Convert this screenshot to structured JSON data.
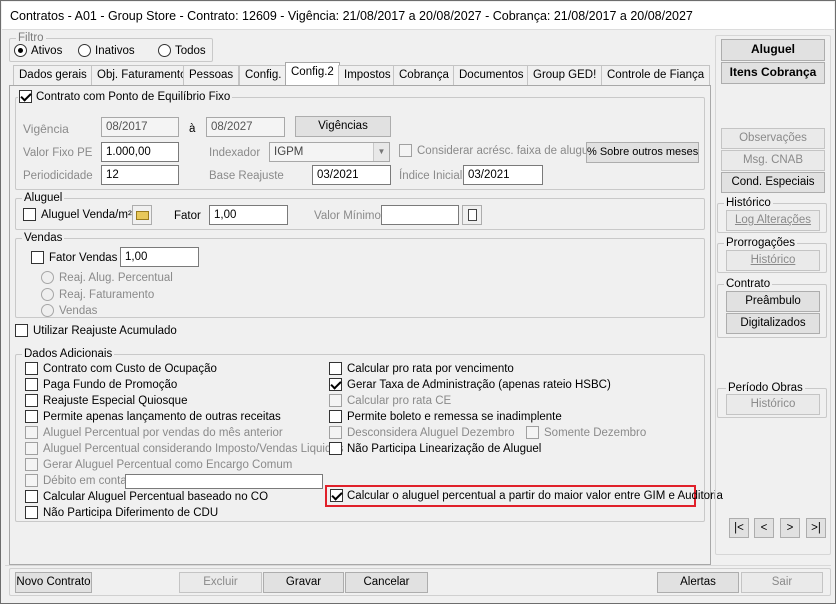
{
  "window": {
    "title": "Contratos - A01 - Group Store - Contrato: 12609 - Vigência: 21/08/2017 a 20/08/2027 - Cobrança: 21/08/2017 a 20/08/2027"
  },
  "filtro": {
    "label": "Filtro",
    "options": [
      "Ativos",
      "Inativos",
      "Todos"
    ],
    "selected": "Ativos"
  },
  "tabs": [
    "Dados gerais",
    "Obj. Faturamento",
    "Pessoas",
    "Config.",
    "Config.2",
    "Impostos",
    "Cobrança",
    "Documentos",
    "Group GED!",
    "Controle de Fiança"
  ],
  "active_tab": "Config.2",
  "pe": {
    "title": "Contrato com Ponto de Equilíbrio Fixo",
    "vigencia_label": "Vigência",
    "vigencia_from": "08/2017",
    "a_label": "à",
    "vigencia_to": "08/2027",
    "vigencias_button": "Vigências",
    "valor_fixo_label": "Valor Fixo PE",
    "valor_fixo": "1.000,00",
    "indexador_label": "Indexador",
    "indexador": "IGPM",
    "considerar_label": "Considerar acrésc. faixa de aluguel",
    "sobre_outros_button": "% Sobre outros meses",
    "periodicidade_label": "Periodicidade",
    "periodicidade": "12",
    "base_reajuste_label": "Base Reajuste",
    "base_reajuste": "03/2021",
    "indice_inicial_label": "Índice Inicial",
    "indice_inicial": "03/2021"
  },
  "aluguel": {
    "title": "Aluguel",
    "venda_m2_label": "Aluguel Venda/m²",
    "fator_label": "Fator",
    "fator": "1,00",
    "valor_minimo_label": "Valor Mínimo",
    "valor_minimo": ""
  },
  "vendas": {
    "title": "Vendas",
    "fator_vendas_label": "Fator Vendas",
    "fator_vendas": "1,00",
    "radios": [
      "Reaj. Alug. Percentual",
      "Reaj. Faturamento",
      "Vendas"
    ]
  },
  "reajuste_acumulado_label": "Utilizar Reajuste Acumulado",
  "dados": {
    "title": "Dados Adicionais",
    "left": [
      {
        "label": "Contrato com Custo de Ocupação",
        "checked": false,
        "enabled": true
      },
      {
        "label": "Paga Fundo de Promoção",
        "checked": false,
        "enabled": true
      },
      {
        "label": "Reajuste Especial Quiosque",
        "checked": false,
        "enabled": true
      },
      {
        "label": "Permite apenas lançamento de outras receitas",
        "checked": false,
        "enabled": true
      },
      {
        "label": "Aluguel Percentual por vendas do mês anterior",
        "checked": false,
        "enabled": false
      },
      {
        "label": "Aluguel Percentual considerando Imposto/Vendas Liquidas",
        "checked": false,
        "enabled": false
      },
      {
        "label": "Gerar Aluguel Percentual como Encargo Comum",
        "checked": false,
        "enabled": false
      },
      {
        "label": "Débito em conta",
        "checked": false,
        "enabled": false
      },
      {
        "label": "Calcular Aluguel Percentual baseado no CO",
        "checked": false,
        "enabled": true
      },
      {
        "label": "Não Participa Diferimento de CDU",
        "checked": false,
        "enabled": true
      }
    ],
    "right": [
      {
        "label": "Calcular pro rata por vencimento",
        "checked": false,
        "enabled": true
      },
      {
        "label": "Gerar Taxa de Administração (apenas rateio HSBC)",
        "checked": true,
        "enabled": true
      },
      {
        "label": "Calcular pro rata CE",
        "checked": false,
        "enabled": false
      },
      {
        "label": "Permite boleto e remessa se inadimplente",
        "checked": false,
        "enabled": true
      },
      {
        "label": "Desconsidera Aluguel Dezembro",
        "checked": false,
        "enabled": false
      },
      {
        "label": "Não Participa Linearização de Aluguel",
        "checked": false,
        "enabled": true
      }
    ],
    "somente_dezembro_label": "Somente Dezembro",
    "highlight_label": "Calcular o aluguel percentual a partir do maior valor entre GIM e Auditoria"
  },
  "side": {
    "aluguel_button": "Aluguel",
    "itens_cobranca_button": "Itens Cobrança",
    "observacoes_button": "Observações",
    "msg_cnab_button": "Msg. CNAB",
    "cond_especiais_button": "Cond. Especiais",
    "historico_title": "Histórico",
    "log_button": "Log Alterações",
    "prorrogacoes_title": "Prorrogações",
    "prorrogacoes_hist_button": "Histórico",
    "contrato_title": "Contrato",
    "preambulo_button": "Preâmbulo",
    "digitalizados_button": "Digitalizados",
    "periodo_obras_title": "Período Obras",
    "periodo_obras_hist_button": "Histórico",
    "nav": [
      "|<",
      "<",
      ">",
      ">|"
    ]
  },
  "footer": {
    "novo": "Novo Contrato",
    "excluir": "Excluir",
    "gravar": "Gravar",
    "cancelar": "Cancelar",
    "alertas": "Alertas",
    "sair": "Sair"
  },
  "colors": {
    "highlight": "#e0202a"
  }
}
